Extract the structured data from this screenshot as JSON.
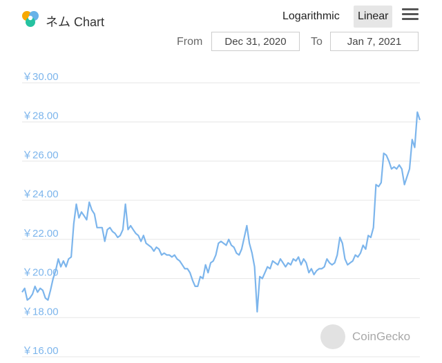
{
  "header": {
    "title": "ネム Chart",
    "scale_log": "Logarithmic",
    "scale_linear": "Linear",
    "from_label": "From",
    "to_label": "To",
    "from_date": "Dec 31, 2020",
    "to_date": "Jan 7, 2021"
  },
  "watermark": "CoinGecko",
  "colors": {
    "line": "#7cb5ec",
    "grid": "#e6e6e6",
    "axis_label": "#7cb5ec"
  },
  "chart_data": {
    "type": "line",
    "xlabel": "",
    "ylabel": "",
    "ylim": [
      16,
      30
    ],
    "yticks": [
      16,
      18,
      20,
      22,
      24,
      26,
      28,
      30
    ],
    "ytick_labels": [
      "￥16.00",
      "￥18.00",
      "￥20.00",
      "￥22.00",
      "￥24.00",
      "￥26.00",
      "￥28.00",
      "￥30.00"
    ],
    "x_range": [
      "Dec 31, 2020",
      "Jan 7, 2021"
    ],
    "grid": true,
    "series": [
      {
        "values": [
          19.3,
          19.5,
          18.9,
          19.0,
          19.2,
          19.6,
          19.3,
          19.5,
          19.4,
          19.0,
          18.9,
          19.4,
          20.0,
          20.4,
          21.0,
          20.6,
          20.9,
          20.6,
          21.0,
          21.1,
          22.8,
          23.8,
          23.1,
          23.4,
          23.2,
          23.0,
          23.9,
          23.5,
          23.3,
          22.6,
          22.6,
          22.6,
          21.9,
          22.5,
          22.6,
          22.4,
          22.3,
          22.1,
          22.2,
          22.5,
          23.8,
          22.5,
          22.7,
          22.5,
          22.3,
          22.2,
          21.9,
          22.2,
          21.8,
          21.7,
          21.6,
          21.4,
          21.6,
          21.5,
          21.2,
          21.3,
          21.2,
          21.2,
          21.1,
          21.2,
          21.0,
          20.9,
          20.7,
          20.5,
          20.5,
          20.3,
          19.9,
          19.6,
          19.6,
          20.1,
          20.0,
          20.7,
          20.3,
          20.8,
          20.9,
          21.2,
          21.8,
          21.9,
          21.8,
          21.7,
          22.0,
          21.7,
          21.6,
          21.3,
          21.2,
          21.5,
          22.1,
          22.7,
          21.8,
          21.3,
          20.6,
          18.3,
          20.1,
          20.0,
          20.3,
          20.6,
          20.5,
          20.9,
          20.8,
          20.7,
          21.0,
          20.8,
          20.6,
          20.8,
          20.7,
          21.0,
          20.9,
          21.1,
          20.7,
          21.0,
          20.8,
          20.3,
          20.5,
          20.2,
          20.4,
          20.5,
          20.5,
          20.6,
          21.0,
          20.8,
          20.7,
          20.8,
          21.2,
          22.1,
          21.8,
          21.0,
          20.7,
          20.8,
          20.9,
          21.2,
          21.1,
          21.3,
          21.7,
          21.5,
          22.2,
          22.1,
          22.6,
          24.8,
          24.7,
          24.9,
          26.4,
          26.3,
          26.0,
          25.6,
          25.7,
          25.6,
          25.8,
          25.6,
          24.8,
          25.2,
          25.6,
          27.1,
          26.7,
          28.5,
          28.1
        ]
      }
    ]
  }
}
